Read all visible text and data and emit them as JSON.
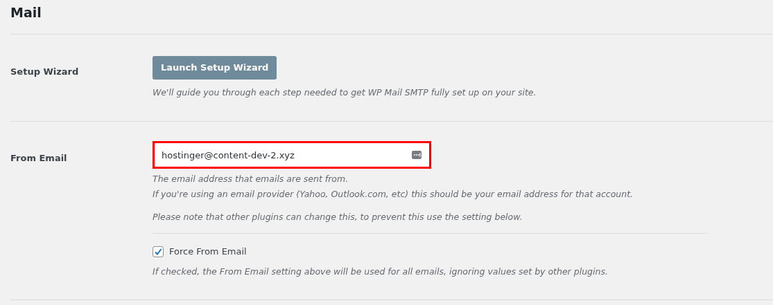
{
  "title": "Mail",
  "setup_wizard": {
    "label": "Setup Wizard",
    "button": "Launch Setup Wizard",
    "description": "We'll guide you through each step needed to get WP Mail SMTP fully set up on your site."
  },
  "from_email": {
    "label": "From Email",
    "value": "hostinger@content-dev-2.xyz",
    "highlighted": true,
    "descriptions": [
      "The email address that emails are sent from.",
      "If you're using an email provider (Yahoo, Outlook.com, etc) this should be your email address for that account."
    ],
    "note": "Please note that other plugins can change this, to prevent this use the setting below.",
    "force": {
      "label": "Force From Email",
      "checked": true,
      "description": "If checked, the From Email setting above will be used for all emails, ignoring values set by other plugins."
    }
  }
}
